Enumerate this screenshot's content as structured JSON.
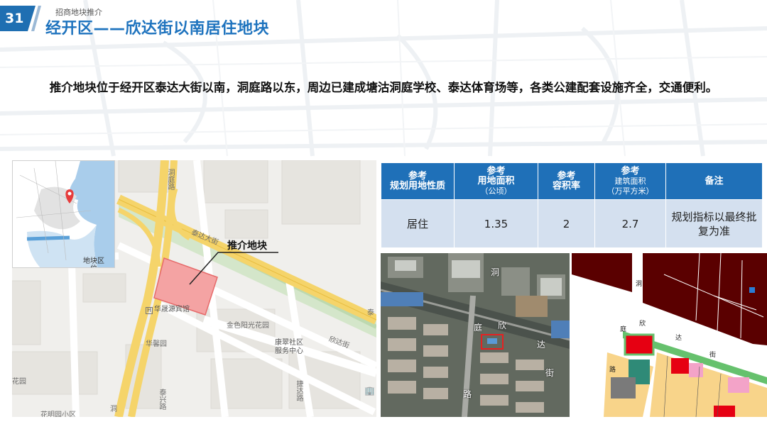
{
  "header": {
    "page_number": "31",
    "subtitle": "招商地块推介",
    "title": "经开区——欣达街以南居住地块"
  },
  "intro": "推介地块位于经开区泰达大街以南，洞庭路以东，周边已建成塘沽洞庭学校、泰达体育场等，各类公建配套设施齐全，交通便利。",
  "map": {
    "callout": "推介地块",
    "labels": {
      "dongting_road": "洞庭路",
      "taida_street": "泰达大街",
      "taida_right": "泰",
      "hotel": "华晟源宾馆",
      "hotel_icon_glyph": "H",
      "jinse": "金色阳光花园",
      "kangcui": "康翠社区服务中心",
      "kangcui_line1": "康翠社区",
      "kangcui_line2": "服务中心",
      "xinda": "欣达街",
      "huaxin": "华馨园",
      "garden_left": "花园",
      "taixing": "泰兴路",
      "jieda": "捷达路",
      "huaming": "花明园小区",
      "dong_bottom": "洞"
    },
    "inset": {
      "label": "地块区位",
      "label_line1": "地块区",
      "label_line2": "位"
    },
    "colors": {
      "road_yellow": "#f5d46a",
      "green_strip": "#cfe3c4",
      "parcel": "#f4a3a3",
      "sea": "#a9cdeb"
    }
  },
  "table": {
    "headers": [
      {
        "top": "参考",
        "main": "规划用地性质",
        "unit": ""
      },
      {
        "top": "参考",
        "main": "用地面积",
        "unit": "（公顷）"
      },
      {
        "top": "参考",
        "main": "容积率",
        "unit": ""
      },
      {
        "top": "参考",
        "main": "建筑面积",
        "unit": "（万平方米）"
      },
      {
        "top": "",
        "main": "备注",
        "unit": ""
      }
    ],
    "row": {
      "land_use": "居住",
      "area": "1.35",
      "far": "2",
      "floor_area": "2.7",
      "note": "规划指标以最终批复为准"
    },
    "colors": {
      "header_bg": "#1f70b8",
      "cell_bg": "#d4e0ef"
    }
  },
  "aerial": {
    "labels": {
      "dong": "洞",
      "ting": "庭",
      "lu": "路",
      "xin": "欣",
      "da": "达",
      "jie": "街"
    }
  },
  "plan": {
    "labels": {
      "dong": "洞",
      "ting": "庭",
      "xin": "欣",
      "da": "达",
      "jie": "街",
      "lu": "路"
    },
    "colors": {
      "dark_red": "#5a0000",
      "red": "#e60012",
      "yellow": "#f8d48a",
      "pink": "#f3a3c8",
      "green": "#66c16d"
    }
  }
}
